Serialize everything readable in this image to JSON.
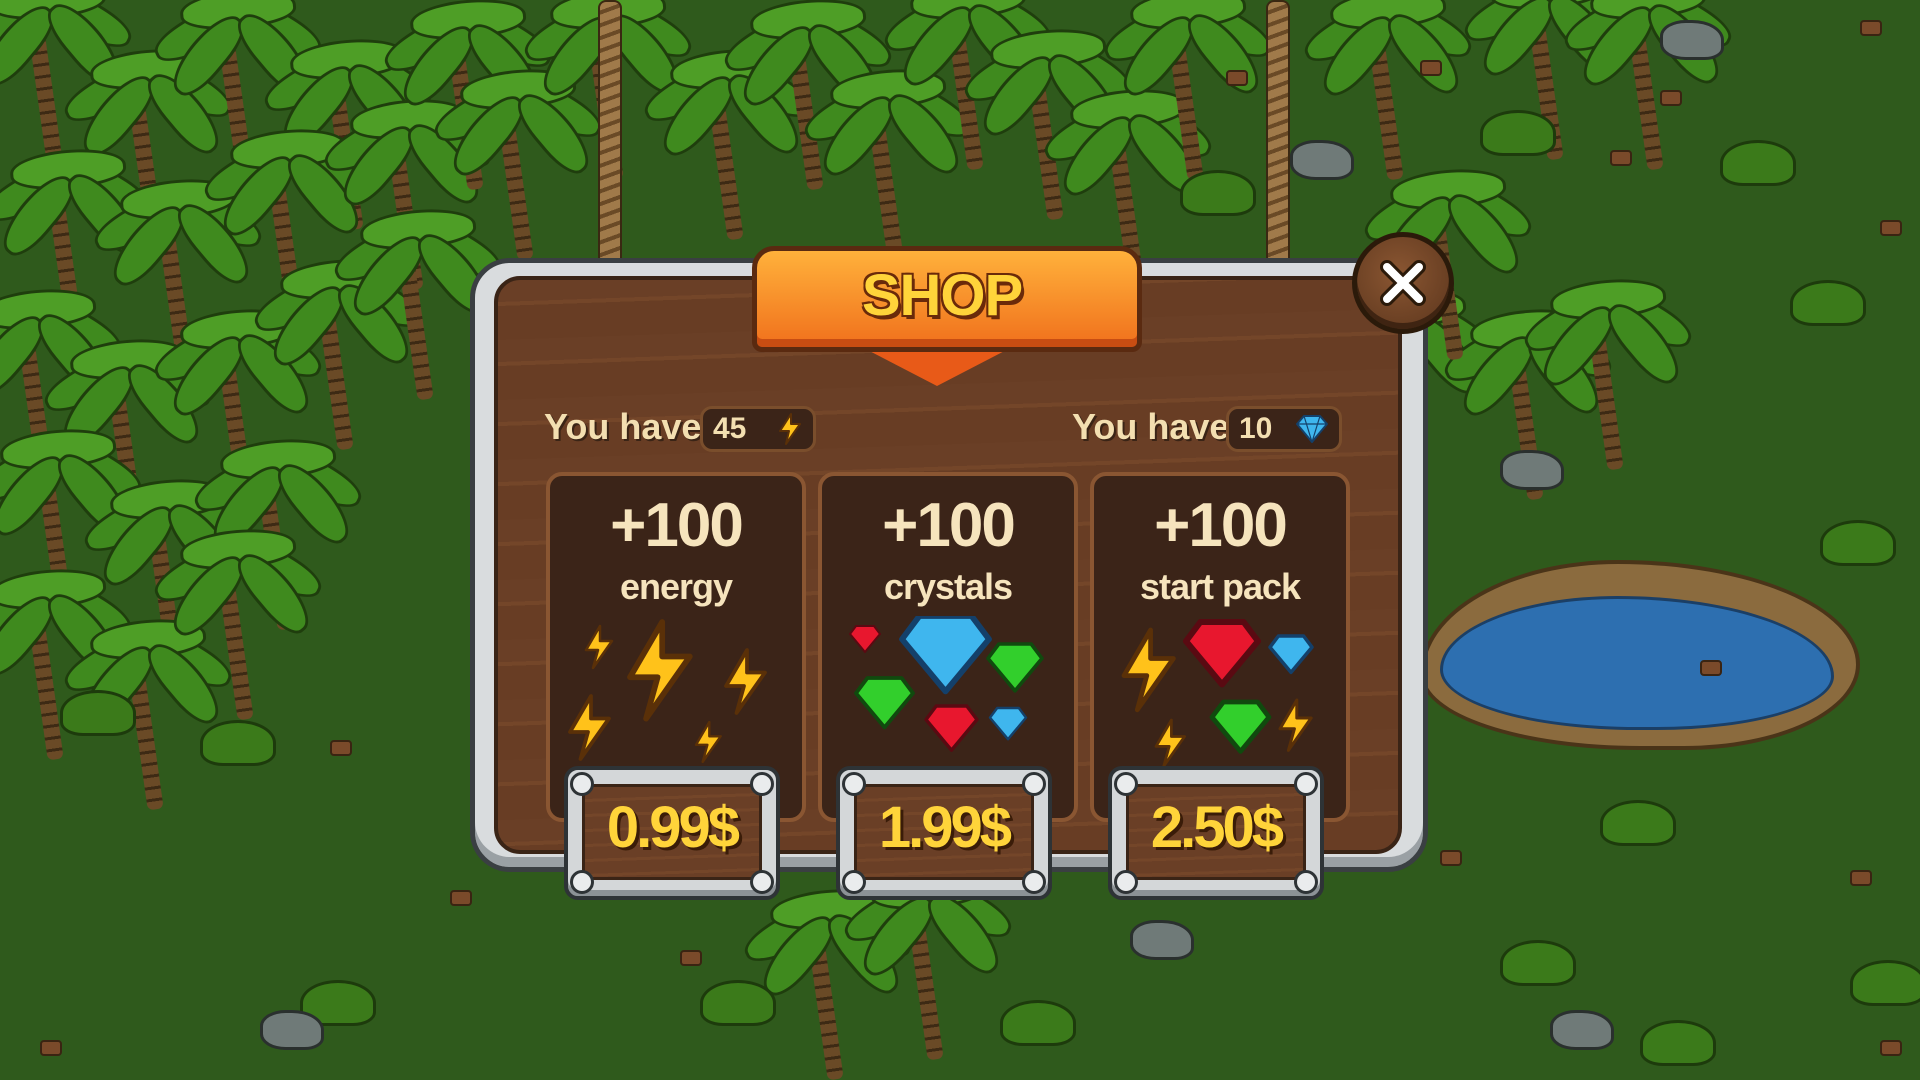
{
  "shop": {
    "title": "SHOP",
    "close_icon": "close-x-icon",
    "balances": [
      {
        "label": "You have",
        "value": "45",
        "icon": "lightning-bolt-icon"
      },
      {
        "label": "You have",
        "value": "10",
        "icon": "blue-crystal-icon"
      }
    ],
    "offers": [
      {
        "amount": "+100",
        "label": "energy",
        "price": "0.99$",
        "art": "lightning-bolts-art"
      },
      {
        "amount": "+100",
        "label": "crystals",
        "price": "1.99$",
        "art": "crystals-art"
      },
      {
        "amount": "+100",
        "label": "start pack",
        "price": "2.50$",
        "art": "start-pack-art"
      }
    ]
  },
  "colors": {
    "title_text": "#ffd43a",
    "price_text": "#ffd43a",
    "wood": "#6a3f26",
    "card_bg": "#3b2418",
    "banner": "#f0701c",
    "frame": "#d9dcde",
    "grass": "#2f5a1c"
  }
}
